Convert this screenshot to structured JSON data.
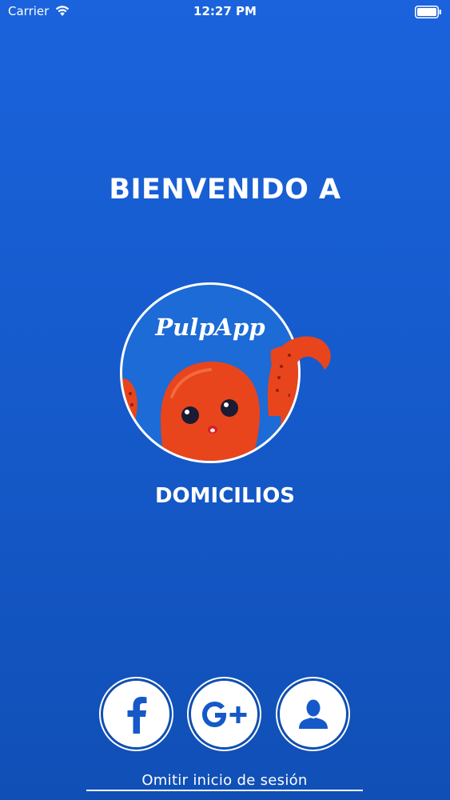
{
  "status_bar": {
    "carrier": "Carrier",
    "time": "12:27 PM",
    "wifi_icon": "wifi-icon",
    "battery_icon": "battery-icon"
  },
  "welcome": {
    "title": "BIENVENIDO A"
  },
  "logo": {
    "brand": "PulpApp",
    "subtitle": "DOMICILIOS",
    "mascot": "octopus-mascot-icon"
  },
  "login": {
    "facebook_icon": "facebook-icon",
    "google_icon": "google-plus-icon",
    "user_icon": "user-icon",
    "skip_label": "Omitir inicio de sesión"
  },
  "colors": {
    "background": "#1a63dc",
    "octopus": "#e8451c",
    "button_icon": "#1559c9",
    "white": "#ffffff"
  }
}
